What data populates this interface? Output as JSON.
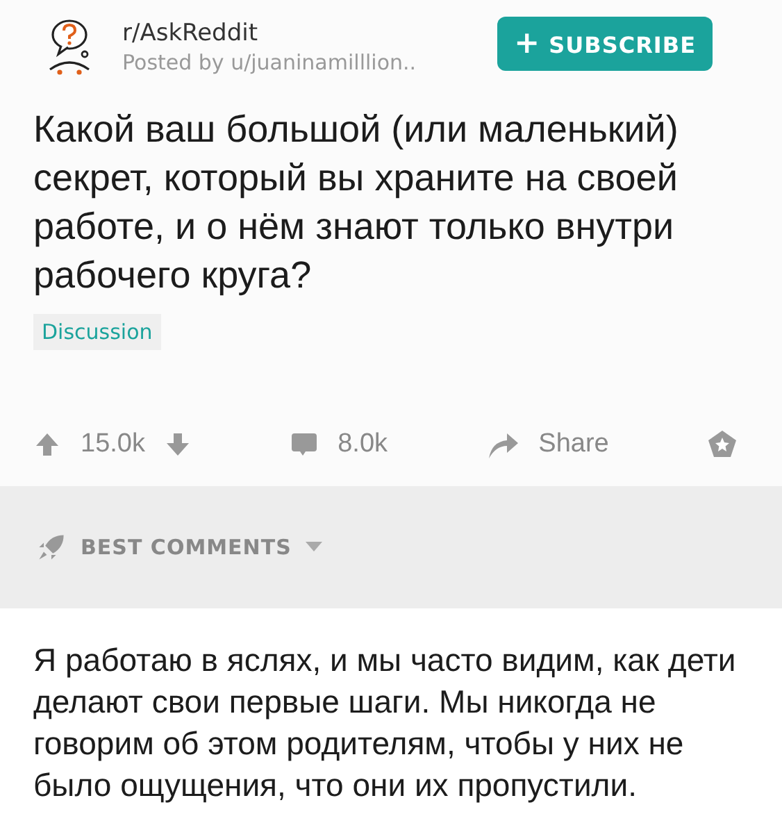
{
  "post": {
    "subreddit": "r/AskReddit",
    "posted_by": "Posted by u/juaninamilllion..",
    "subscribe_label": "SUBSCRIBE",
    "subscribe_icon": "+",
    "title": "Какой ваш большой (или маленький) секрет, который вы храните на своей работе, и о нём знают только внутри рабочего круга?",
    "flair": "Discussion",
    "upvotes": "15.0k",
    "comments": "8.0k",
    "share": "Share"
  },
  "sort": {
    "label": "BEST COMMENTS"
  },
  "comment": {
    "text": "Я работаю в яслях, и мы часто видим, как дети делают свои первые шаги. Мы никогда не говорим об этом родителям, чтобы у них не было ощущения, что они их пропустили."
  }
}
